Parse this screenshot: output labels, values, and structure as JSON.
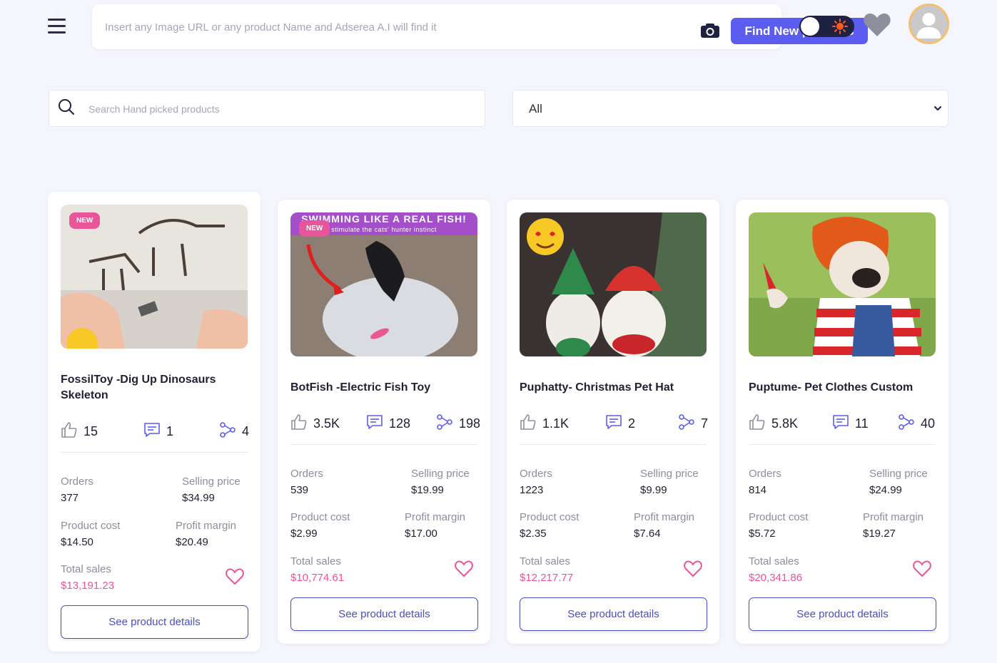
{
  "header": {
    "search_placeholder": "Insert any Image URL or any product Name and Adserea A.I will find it",
    "find_button": "Find New products"
  },
  "filters": {
    "search_placeholder": "Search Hand picked products",
    "category_selected": "All"
  },
  "labels": {
    "orders": "Orders",
    "selling_price": "Selling price",
    "product_cost": "Product cost",
    "profit_margin": "Profit margin",
    "total_sales": "Total sales",
    "details_button": "See product details"
  },
  "colors": {
    "accent": "#5b5cf0",
    "pink": "#e8559a",
    "outline": "#4b4ec1"
  },
  "products": [
    {
      "badge": "NEW",
      "title": "FossilToy -Dig Up Dinosaurs Skeleton",
      "likes": "15",
      "comments": "1",
      "shares": "4",
      "orders": "377",
      "selling_price": "$34.99",
      "product_cost": "$14.50",
      "profit_margin": "$20.49",
      "total_sales": "$13,191.23"
    },
    {
      "badge": "NEW",
      "image_caption": "SWIMMING LIKE A REAL FISH!",
      "image_subcaption": "stimulate the cats' hunter instinct",
      "title": "BotFish -Electric Fish Toy",
      "likes": "3.5K",
      "comments": "128",
      "shares": "198",
      "orders": "539",
      "selling_price": "$19.99",
      "product_cost": "$2.99",
      "profit_margin": "$17.00",
      "total_sales": "$10,774.61"
    },
    {
      "title": "Puphatty- Christmas Pet Hat",
      "likes": "1.1K",
      "comments": "2",
      "shares": "7",
      "orders": "1223",
      "selling_price": "$9.99",
      "product_cost": "$2.35",
      "profit_margin": "$7.64",
      "total_sales": "$12,217.77"
    },
    {
      "title": "Puptume- Pet Clothes Custom",
      "likes": "5.8K",
      "comments": "11",
      "shares": "40",
      "orders": "814",
      "selling_price": "$24.99",
      "product_cost": "$5.72",
      "profit_margin": "$19.27",
      "total_sales": "$20,341.86"
    }
  ]
}
